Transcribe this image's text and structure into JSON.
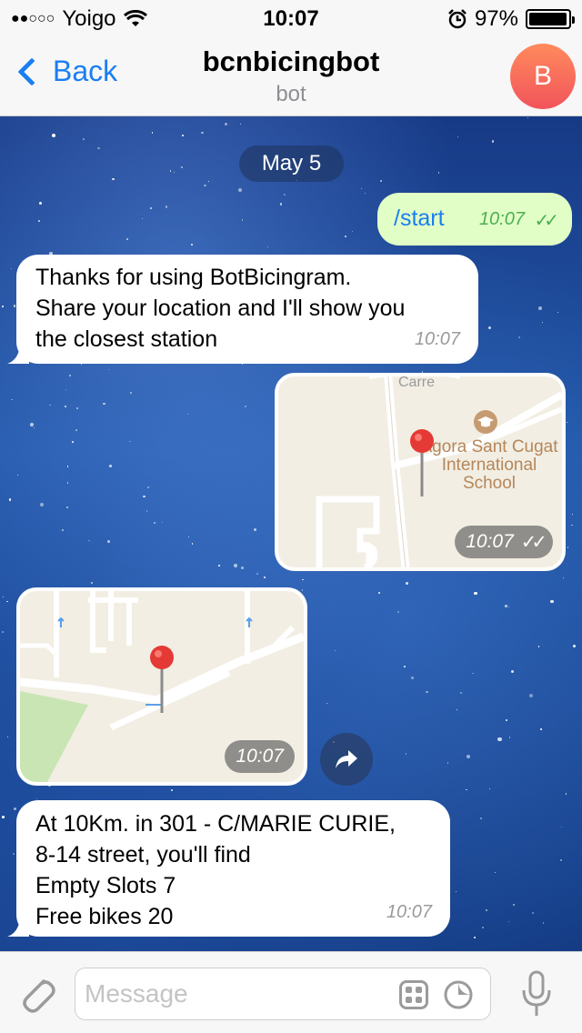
{
  "status_bar": {
    "carrier": "Yoigo",
    "signal": "●●○○○",
    "time": "10:07",
    "battery": "97%",
    "battery_level": 0.97
  },
  "nav": {
    "back_label": "Back",
    "title": "bcnbicingbot",
    "subtitle": "bot",
    "avatar_letter": "B",
    "avatar_color": "#f2545b"
  },
  "chat": {
    "date": "May 5",
    "messages": [
      {
        "direction": "outgoing",
        "text": "/start",
        "time": "10:07",
        "status": "read"
      },
      {
        "direction": "incoming",
        "text": "Thanks for using BotBicingram.\nShare your location and I'll show you\nthe closest station",
        "time": "10:07"
      },
      {
        "direction": "outgoing",
        "type": "location",
        "map_label": "Agora Sant Cugat International School",
        "map_street": "Carre",
        "time": "10:07",
        "status": "read"
      },
      {
        "direction": "incoming",
        "type": "location",
        "time": "10:07"
      },
      {
        "direction": "incoming",
        "text": "At 10Km. in 301 - C/MARIE CURIE,\n8-14 street, you'll find\nEmpty Slots 7\nFree bikes  20",
        "time": "10:07"
      }
    ]
  },
  "input": {
    "placeholder": "Message"
  },
  "colors": {
    "accent": "#1a7ef2",
    "outgoing_bubble": "#e1fec6",
    "incoming_bubble": "#ffffff",
    "read_check": "#4caf50"
  }
}
